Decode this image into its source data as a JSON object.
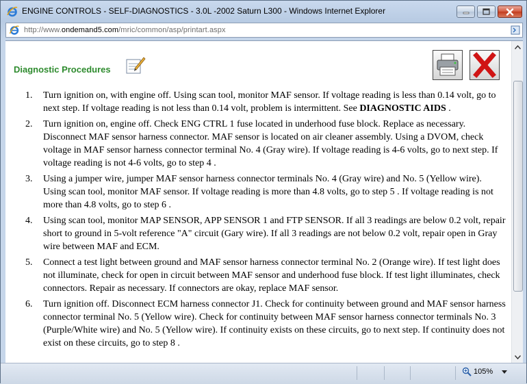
{
  "window": {
    "title": "ENGINE CONTROLS - SELF-DIAGNOSTICS - 3.0L -2002 Saturn L300 - Windows Internet Explorer",
    "controls": [
      "minimize-icon",
      "maximize-icon",
      "close-icon"
    ]
  },
  "address": {
    "url_prefix": "http://www.",
    "url_domain": "ondemand5.com",
    "url_path": "/mric/common/asp/printart.aspx"
  },
  "page": {
    "heading": "Diagnostic Procedures",
    "icons": [
      "notepad-pencil-icon",
      "printer-icon",
      "red-x-close-icon"
    ],
    "steps": [
      {
        "num": "1.",
        "text": "Turn ignition on, with engine off. Using scan tool, monitor MAF sensor. If voltage reading is less than 0.14 volt, go to next step. If voltage reading is not less than 0.14 volt, problem is intermittent. See ",
        "bold": "DIAGNOSTIC AIDS",
        "tail": " ."
      },
      {
        "num": "2.",
        "text": "Turn ignition on, engine off. Check ENG CTRL 1 fuse located in underhood fuse block. Replace as necessary. Disconnect MAF sensor harness connector. MAF sensor is located on air cleaner assembly. Using a DVOM, check voltage in MAF sensor harness connector terminal No. 4 (Gray wire). If voltage reading is 4-6 volts, go to next step. If voltage reading is not 4-6 volts, go to step 4 .",
        "bold": "",
        "tail": ""
      },
      {
        "num": "3.",
        "text": "Using a jumper wire, jumper MAF sensor harness connector terminals No. 4 (Gray wire) and No. 5 (Yellow wire). Using scan tool, monitor MAF sensor. If voltage reading is more than 4.8 volts, go to step 5 . If voltage reading is not more than 4.8 volts, go to step 6 .",
        "bold": "",
        "tail": ""
      },
      {
        "num": "4.",
        "text": "Using scan tool, monitor MAP SENSOR, APP SENSOR 1 and FTP SENSOR. If all 3 readings are below 0.2 volt, repair short to ground in 5-volt reference \"A\" circuit (Gary wire). If all 3 readings are not below 0.2 volt, repair open in Gray wire between MAF and ECM.",
        "bold": "",
        "tail": ""
      },
      {
        "num": "5.",
        "text": "Connect a test light between ground and MAF sensor harness connector terminal No. 2 (Orange wire). If test light does not illuminate, check for open in circuit between MAF sensor and underhood fuse block. If test light illuminates, check connectors. Repair as necessary. If connectors are okay, replace MAF sensor.",
        "bold": "",
        "tail": ""
      },
      {
        "num": "6.",
        "text": "Turn ignition off. Disconnect ECM harness connector J1. Check for continuity between ground and MAF sensor harness connector terminal No. 5 (Yellow wire). Check for continuity between MAF sensor harness connector terminals No. 3 (Purple/White wire) and No. 5 (Yellow wire). If continuity exists on these circuits, go to next step. If continuity does not exist on these circuits, go to step 8 .",
        "bold": "",
        "tail": ""
      }
    ]
  },
  "status": {
    "zoom": "105%",
    "zoom_icon": "magnifier-icon"
  }
}
